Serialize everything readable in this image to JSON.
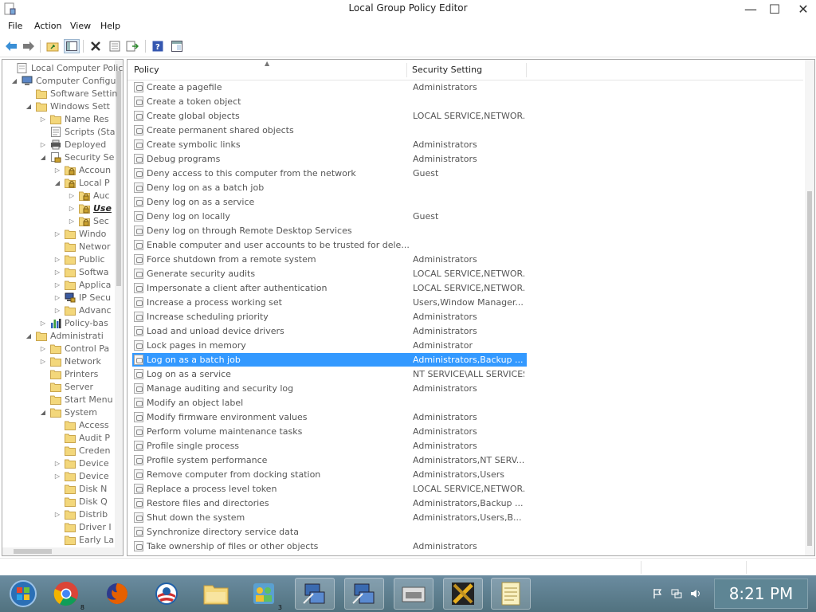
{
  "window": {
    "title": "Local Group Policy Editor"
  },
  "menu": [
    "File",
    "Action",
    "View",
    "Help"
  ],
  "toolbar_icons": [
    "back-arrow-icon",
    "forward-arrow-icon",
    "up-folder-icon",
    "show-hide-tree-icon",
    "delete-icon",
    "properties-icon",
    "export-list-icon",
    "help-icon",
    "console-view-icon"
  ],
  "tree": [
    {
      "label": "Local Computer Polic",
      "level": 0,
      "exp": "",
      "icon": "policy"
    },
    {
      "label": "Computer Configu",
      "level": 1,
      "exp": "◢",
      "icon": "computer"
    },
    {
      "label": "Software Settin",
      "level": 2,
      "exp": "",
      "icon": "folder"
    },
    {
      "label": "Windows Sett",
      "level": 2,
      "exp": "◢",
      "icon": "folder"
    },
    {
      "label": "Name Res",
      "level": 3,
      "exp": "▷",
      "icon": "folder"
    },
    {
      "label": "Scripts (Sta",
      "level": 3,
      "exp": "",
      "icon": "script"
    },
    {
      "label": "Deployed",
      "level": 3,
      "exp": "▷",
      "icon": "printer"
    },
    {
      "label": "Security Se",
      "level": 3,
      "exp": "◢",
      "icon": "security"
    },
    {
      "label": "Accoun",
      "level": 4,
      "exp": "▷",
      "icon": "folder-lock"
    },
    {
      "label": "Local P",
      "level": 4,
      "exp": "◢",
      "icon": "folder-lock"
    },
    {
      "label": "Auc",
      "level": 5,
      "exp": "▷",
      "icon": "folder-lock"
    },
    {
      "label": "Use",
      "level": 5,
      "exp": "▷",
      "icon": "folder-lock"
    },
    {
      "label": "Sec",
      "level": 5,
      "exp": "▷",
      "icon": "folder-lock"
    },
    {
      "label": "Windo",
      "level": 4,
      "exp": "▷",
      "icon": "folder"
    },
    {
      "label": "Networ",
      "level": 4,
      "exp": "",
      "icon": "folder"
    },
    {
      "label": "Public",
      "level": 4,
      "exp": "▷",
      "icon": "folder"
    },
    {
      "label": "Softwa",
      "level": 4,
      "exp": "▷",
      "icon": "folder"
    },
    {
      "label": "Applica",
      "level": 4,
      "exp": "▷",
      "icon": "folder"
    },
    {
      "label": "IP Secu",
      "level": 4,
      "exp": "▷",
      "icon": "ipsec"
    },
    {
      "label": "Advanc",
      "level": 4,
      "exp": "▷",
      "icon": "folder"
    },
    {
      "label": "Policy-bas",
      "level": 3,
      "exp": "▷",
      "icon": "chart"
    },
    {
      "label": "Administrati",
      "level": 2,
      "exp": "◢",
      "icon": "folder"
    },
    {
      "label": "Control Pa",
      "level": 3,
      "exp": "▷",
      "icon": "folder"
    },
    {
      "label": "Network",
      "level": 3,
      "exp": "▷",
      "icon": "folder"
    },
    {
      "label": "Printers",
      "level": 3,
      "exp": "",
      "icon": "folder"
    },
    {
      "label": "Server",
      "level": 3,
      "exp": "",
      "icon": "folder"
    },
    {
      "label": "Start Menu",
      "level": 3,
      "exp": "",
      "icon": "folder"
    },
    {
      "label": "System",
      "level": 3,
      "exp": "◢",
      "icon": "folder"
    },
    {
      "label": "Access",
      "level": 4,
      "exp": "",
      "icon": "folder"
    },
    {
      "label": "Audit P",
      "level": 4,
      "exp": "",
      "icon": "folder"
    },
    {
      "label": "Creden",
      "level": 4,
      "exp": "",
      "icon": "folder"
    },
    {
      "label": "Device",
      "level": 4,
      "exp": "▷",
      "icon": "folder"
    },
    {
      "label": "Device",
      "level": 4,
      "exp": "▷",
      "icon": "folder"
    },
    {
      "label": "Disk N",
      "level": 4,
      "exp": "",
      "icon": "folder"
    },
    {
      "label": "Disk Q",
      "level": 4,
      "exp": "",
      "icon": "folder"
    },
    {
      "label": "Distrib",
      "level": 4,
      "exp": "▷",
      "icon": "folder"
    },
    {
      "label": "Driver I",
      "level": 4,
      "exp": "",
      "icon": "folder"
    },
    {
      "label": "Early La",
      "level": 4,
      "exp": "",
      "icon": "folder"
    }
  ],
  "list": {
    "columns": [
      "Policy",
      "Security Setting"
    ],
    "rows": [
      {
        "policy": "Create a pagefile",
        "setting": "Administrators"
      },
      {
        "policy": "Create a token object",
        "setting": ""
      },
      {
        "policy": "Create global objects",
        "setting": "LOCAL SERVICE,NETWOR..."
      },
      {
        "policy": "Create permanent shared objects",
        "setting": ""
      },
      {
        "policy": "Create symbolic links",
        "setting": "Administrators"
      },
      {
        "policy": "Debug programs",
        "setting": "Administrators"
      },
      {
        "policy": "Deny access to this computer from the network",
        "setting": "Guest"
      },
      {
        "policy": "Deny log on as a batch job",
        "setting": ""
      },
      {
        "policy": "Deny log on as a service",
        "setting": ""
      },
      {
        "policy": "Deny log on locally",
        "setting": "Guest"
      },
      {
        "policy": "Deny log on through Remote Desktop Services",
        "setting": ""
      },
      {
        "policy": "Enable computer and user accounts to be trusted for dele...",
        "setting": ""
      },
      {
        "policy": "Force shutdown from a remote system",
        "setting": "Administrators"
      },
      {
        "policy": "Generate security audits",
        "setting": "LOCAL SERVICE,NETWOR..."
      },
      {
        "policy": "Impersonate a client after authentication",
        "setting": "LOCAL SERVICE,NETWOR..."
      },
      {
        "policy": "Increase a process working set",
        "setting": "Users,Window Manager..."
      },
      {
        "policy": "Increase scheduling priority",
        "setting": "Administrators"
      },
      {
        "policy": "Load and unload device drivers",
        "setting": "Administrators"
      },
      {
        "policy": "Lock pages in memory",
        "setting": "Administrator"
      },
      {
        "policy": "Log on as a batch job",
        "setting": "Administrators,Backup ...",
        "selected": true
      },
      {
        "policy": "Log on as a service",
        "setting": "NT SERVICE\\ALL SERVICES"
      },
      {
        "policy": "Manage auditing and security log",
        "setting": "Administrators"
      },
      {
        "policy": "Modify an object label",
        "setting": ""
      },
      {
        "policy": "Modify firmware environment values",
        "setting": "Administrators"
      },
      {
        "policy": "Perform volume maintenance tasks",
        "setting": "Administrators"
      },
      {
        "policy": "Profile single process",
        "setting": "Administrators"
      },
      {
        "policy": "Profile system performance",
        "setting": "Administrators,NT SERV..."
      },
      {
        "policy": "Remove computer from docking station",
        "setting": "Administrators,Users"
      },
      {
        "policy": "Replace a process level token",
        "setting": "LOCAL SERVICE,NETWOR..."
      },
      {
        "policy": "Restore files and directories",
        "setting": "Administrators,Backup ..."
      },
      {
        "policy": "Shut down the system",
        "setting": "Administrators,Users,B..."
      },
      {
        "policy": "Synchronize directory service data",
        "setting": ""
      },
      {
        "policy": "Take ownership of files or other objects",
        "setting": "Administrators"
      }
    ]
  },
  "taskbar": {
    "apps": [
      {
        "name": "start-button",
        "badge": ""
      },
      {
        "name": "chrome-taskbar-icon",
        "badge": "8"
      },
      {
        "name": "firefox-taskbar-icon",
        "badge": ""
      },
      {
        "name": "obama-logo-taskbar-icon",
        "badge": ""
      },
      {
        "name": "file-explorer-taskbar-icon",
        "badge": ""
      },
      {
        "name": "users-app-taskbar-icon",
        "badge": "3"
      },
      {
        "name": "network-computer-taskbar-icon",
        "badge": ""
      },
      {
        "name": "network-computer-2-taskbar-icon",
        "badge": ""
      },
      {
        "name": "device-taskbar-icon",
        "badge": ""
      },
      {
        "name": "tools-taskbar-icon",
        "badge": ""
      },
      {
        "name": "notes-taskbar-icon",
        "badge": ""
      }
    ],
    "clock": "8:21 PM"
  },
  "colors": {
    "selection": "#3399ff",
    "taskbar": "#5e8594",
    "folder": "#f3d77b"
  }
}
